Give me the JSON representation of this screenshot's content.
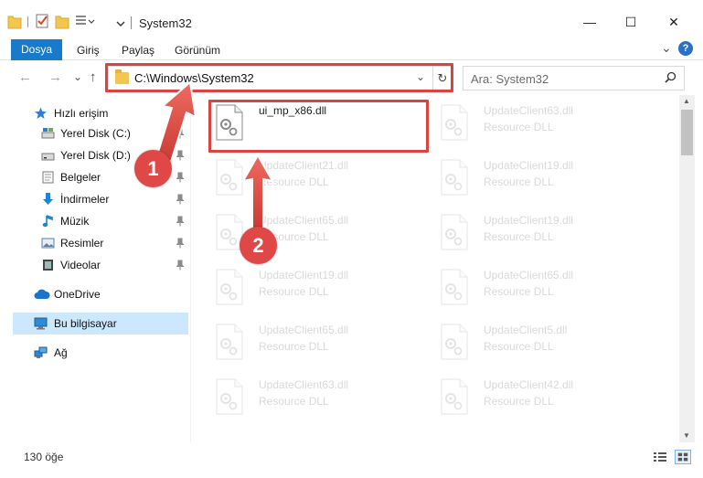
{
  "window": {
    "title": "System32",
    "minimize_glyph": "—",
    "maximize_glyph": "☐",
    "close_glyph": "✕"
  },
  "ribbon": {
    "tabs": [
      "Dosya",
      "Giriş",
      "Paylaş",
      "Görünüm"
    ],
    "expand_glyph": "⌄",
    "help_glyph": "?"
  },
  "address": {
    "path": "C:\\Windows\\System32",
    "back_glyph": "←",
    "forward_glyph": "→",
    "recent_glyph": "⌄",
    "up_glyph": "↑",
    "dropdown_glyph": "⌄",
    "refresh_glyph": "↻"
  },
  "search": {
    "placeholder": "Ara: System32"
  },
  "nav": {
    "quick_access": "Hızlı erişim",
    "items": [
      {
        "label": "Yerel Disk (C:)",
        "icon": "drive-c-icon"
      },
      {
        "label": "Yerel Disk (D:)",
        "icon": "drive-d-icon"
      },
      {
        "label": "Belgeler",
        "icon": "documents-icon"
      },
      {
        "label": "İndirmeler",
        "icon": "downloads-icon"
      },
      {
        "label": "Müzik",
        "icon": "music-icon"
      },
      {
        "label": "Resimler",
        "icon": "pictures-icon"
      },
      {
        "label": "Videolar",
        "icon": "videos-icon"
      }
    ],
    "onedrive": "OneDrive",
    "this_pc": "Bu bilgisayar",
    "network": "Ağ"
  },
  "files": [
    {
      "name": "ui_mp_x86.dll",
      "type": "",
      "highlighted": true
    },
    {
      "name": "UpdateClient63.dll",
      "type": "Resource DLL"
    },
    {
      "name": "UpdateClient21.dll",
      "type": "Resource DLL"
    },
    {
      "name": "UpdateClient19.dll",
      "type": "Resource DLL"
    },
    {
      "name": "UpdateClient65.dll",
      "type": "Resource DLL"
    },
    {
      "name": "UpdateClient19.dll",
      "type": "Resource DLL"
    },
    {
      "name": "UpdateClient19.dll",
      "type": "Resource DLL"
    },
    {
      "name": "UpdateClient65.dll",
      "type": "Resource DLL"
    },
    {
      "name": "UpdateClient65.dll",
      "type": "Resource DLL"
    },
    {
      "name": "UpdateClient5.dll",
      "type": "Resource DLL"
    },
    {
      "name": "UpdateClient63.dll",
      "type": "Resource DLL"
    },
    {
      "name": "UpdateClient42.dll",
      "type": "Resource DLL"
    }
  ],
  "status": {
    "item_count": "130 öğe"
  },
  "annotations": {
    "step1": "1",
    "step2": "2"
  },
  "colors": {
    "accent": "#1979ca",
    "highlight": "#d9453c",
    "callout": "#e04848",
    "selection": "#cce8ff"
  }
}
